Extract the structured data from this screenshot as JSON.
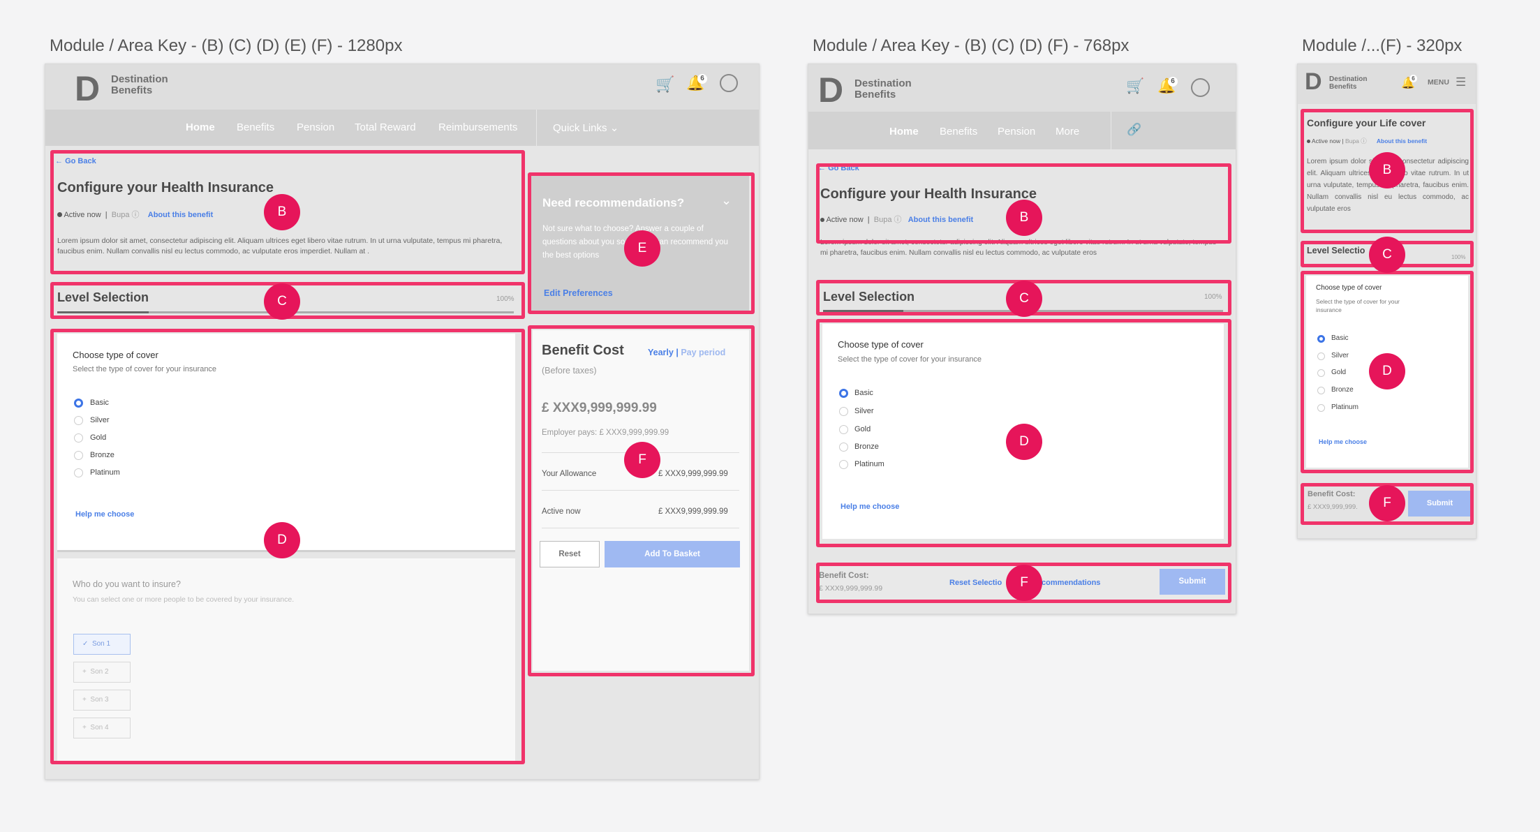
{
  "frames": {
    "desktop_title": "Module / Area Key - (B) (C) (D) (E) (F) - 1280px",
    "tablet_title": "Module / Area Key - (B) (C) (D) (F) - 768px",
    "mobile_title": "Module /...(F) - 320px"
  },
  "brand": {
    "line1": "Destination",
    "line2": "Benefits",
    "mark": "D"
  },
  "header": {
    "cart_icon": "cart-icon",
    "bell_icon": "bell-icon",
    "bell_count": "6",
    "user_icon": "user-icon",
    "menu_label": "MENU"
  },
  "nav": {
    "desktop": [
      "Home",
      "Benefits",
      "Pension",
      "Total Reward",
      "Reimbursements"
    ],
    "quick_links": "Quick Links",
    "tablet": [
      "Home",
      "Benefits",
      "Pension",
      "More"
    ]
  },
  "section_b": {
    "go_back": "Go Back",
    "title": "Configure your Health Insurance",
    "mobile_title": "Configure your Life cover",
    "status": "Active now",
    "provider": "Bupa",
    "about": "About this benefit",
    "body": "Lorem ipsum dolor sit amet, consectetur adipiscing elit. Aliquam ultrices eget libero vitae rutrum. In ut urna vulputate, tempus mi pharetra, faucibus enim. Nullam convallis nisl eu lectus commodo, ac vulputate eros imperdiet. Nullam at .",
    "tablet_body": "Lorem ipsum dolor sit amet, consectetur adipiscing elit. Aliquam ultrices eget libero vitae rutrum. In ut urna vulputate, tempus mi pharetra, faucibus enim. Nullam convallis nisl eu lectus commodo, ac vulputate eros",
    "mobile_body": "Lorem ipsum dolor sit amet, consectetur adipiscing elit. Aliquam ultrices eget libero vitae rutrum. In ut urna vulputate, tempus mi pharetra, faucibus enim. Nullam convallis nisl eu lectus commodo, ac vulputate eros"
  },
  "section_c": {
    "title": "Level Selection",
    "mobile_title": "Level Selectio",
    "percent": "100%",
    "progress": 0.2
  },
  "section_d": {
    "title": "Choose type of cover",
    "subtitle": "Select the type of cover for your insurance",
    "options": [
      "Basic",
      "Silver",
      "Gold",
      "Bronze",
      "Platinum"
    ],
    "selected": "Basic",
    "help": "Help me choose",
    "insure_title": "Who do you want to insure?",
    "insure_sub": "You can select one or more people to be covered by your insurance.",
    "people": [
      "Son 1",
      "Son 2",
      "Son 3",
      "Son 4"
    ]
  },
  "section_e": {
    "title": "Need recommendations?",
    "body": "Not sure what to choose? Answer a couple of questions about you so that we can recommend you the best options",
    "link": "Edit Preferences"
  },
  "section_f": {
    "title": "Benefit Cost",
    "yearly": "Yearly",
    "sep": "|",
    "pay_period": "Pay period",
    "before_taxes": "(Before taxes)",
    "amount": "£ XXX9,999,999.99",
    "employer": "Employer pays: £ XXX9,999,999.99",
    "allowance_label": "Your Allowance",
    "allowance_value": "£ XXX9,999,999.99",
    "active_label": "Active now",
    "active_value": "£ XXX9,999,999.99",
    "reset": "Reset",
    "add": "Add To Basket",
    "footer_label": "Benefit Cost:",
    "footer_amount": "£ XXX9,999,999.99",
    "mobile_amount": "£ XXX9,999,999.",
    "reset_selection": "Reset Selectio",
    "recommendations": "Recommendations",
    "submit": "Submit"
  },
  "keys": {
    "b": "B",
    "c": "C",
    "d": "D",
    "e": "E",
    "f": "F"
  },
  "colors": {
    "annotation": "#f0336a",
    "key_bubble": "#e6155a",
    "link": "#4a7fe6",
    "button": "#9fb9f2"
  }
}
